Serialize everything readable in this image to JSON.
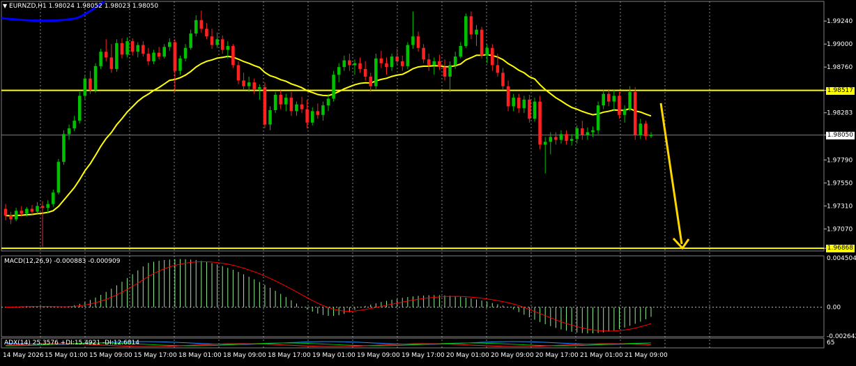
{
  "header": {
    "symbol_line": "EURNZD,H1  1.98024 1.98052 1.98023 1.98050",
    "dropdown_icon": "triangle-down-icon"
  },
  "colors": {
    "background": "#000000",
    "bull": "#00c000",
    "bear": "#ff2020",
    "ma_fast": "#ffff00",
    "ma_slow": "#0000ff",
    "level_line": "#ffff00",
    "macd_hist": "#90ee90",
    "macd_signal": "#ff0000",
    "grid": "#c0c0c0",
    "arrow": "#ffd700"
  },
  "levels": {
    "upper": {
      "value": 1.98517,
      "label": "1.98517"
    },
    "lower": {
      "value": 1.96868,
      "label": "1.96868"
    },
    "current": {
      "value": 1.9805,
      "label": "1.98050"
    }
  },
  "macd": {
    "label": "MACD(12,26,9) -0.000883 -0.000909",
    "ticks": [
      "0.004504",
      "0.00",
      "-0.002642"
    ]
  },
  "adx": {
    "label": "ADX(14) 25.3576 +DI:15.4921 -DI:12.6814",
    "tick": "65"
  },
  "time_labels": [
    "14 May 2026",
    "15 May 01:00",
    "15 May 09:00",
    "15 May 17:00",
    "18 May 01:00",
    "18 May 09:00",
    "18 May 17:00",
    "19 May 01:00",
    "19 May 09:00",
    "19 May 17:00",
    "20 May 01:00",
    "20 May 09:00",
    "20 May 17:00",
    "21 May 01:00",
    "21 May 09:00"
  ],
  "chart_data": {
    "type": "candlestick",
    "symbol": "EURNZD",
    "timeframe": "H1",
    "ylim": [
      1.9684,
      1.9946
    ],
    "price_ticks": [
      "1.99240",
      "1.99000",
      "1.98760",
      "1.98517",
      "1.98283",
      "1.98050",
      "1.97790",
      "1.97550",
      "1.97310",
      "1.97070",
      "1.96868"
    ],
    "candles": [
      [
        1.9728,
        1.9733,
        1.9716,
        1.9721
      ],
      [
        1.9721,
        1.9725,
        1.9712,
        1.9717
      ],
      [
        1.9717,
        1.9729,
        1.9715,
        1.9726
      ],
      [
        1.9726,
        1.9731,
        1.972,
        1.9723
      ],
      [
        1.9723,
        1.973,
        1.972,
        1.9728
      ],
      [
        1.9728,
        1.9732,
        1.9722,
        1.9725
      ],
      [
        1.9725,
        1.9735,
        1.9723,
        1.9731
      ],
      [
        1.9731,
        1.9736,
        1.9688,
        1.9729
      ],
      [
        1.9729,
        1.9737,
        1.9724,
        1.9733
      ],
      [
        1.9733,
        1.9748,
        1.973,
        1.9745
      ],
      [
        1.9745,
        1.978,
        1.9743,
        1.9777
      ],
      [
        1.9777,
        1.981,
        1.9774,
        1.9806
      ],
      [
        1.9806,
        1.9816,
        1.98,
        1.9812
      ],
      [
        1.9812,
        1.9825,
        1.9809,
        1.982
      ],
      [
        1.982,
        1.985,
        1.9817,
        1.9846
      ],
      [
        1.9846,
        1.9868,
        1.9842,
        1.9864
      ],
      [
        1.9864,
        1.9872,
        1.9848,
        1.9852
      ],
      [
        1.9852,
        1.988,
        1.9849,
        1.9877
      ],
      [
        1.9877,
        1.9895,
        1.9874,
        1.9892
      ],
      [
        1.9892,
        1.9905,
        1.9882,
        1.9886
      ],
      [
        1.9886,
        1.99,
        1.987,
        1.9874
      ],
      [
        1.9874,
        1.9905,
        1.9871,
        1.9901
      ],
      [
        1.9901,
        1.9906,
        1.9885,
        1.9889
      ],
      [
        1.9889,
        1.9907,
        1.9886,
        1.9903
      ],
      [
        1.9903,
        1.9906,
        1.9888,
        1.9892
      ],
      [
        1.9892,
        1.9902,
        1.9886,
        1.9899
      ],
      [
        1.9899,
        1.9903,
        1.9887,
        1.989
      ],
      [
        1.989,
        1.9896,
        1.9878,
        1.9882
      ],
      [
        1.9882,
        1.9894,
        1.9879,
        1.9891
      ],
      [
        1.9891,
        1.9897,
        1.9884,
        1.9887
      ],
      [
        1.9887,
        1.99,
        1.9885,
        1.9897
      ],
      [
        1.9897,
        1.9906,
        1.9893,
        1.9902
      ],
      [
        1.9902,
        1.9905,
        1.985,
        1.9872
      ],
      [
        1.9872,
        1.9888,
        1.9868,
        1.9885
      ],
      [
        1.9885,
        1.99,
        1.9882,
        1.9896
      ],
      [
        1.9896,
        1.9915,
        1.9894,
        1.9911
      ],
      [
        1.9911,
        1.993,
        1.9908,
        1.9925
      ],
      [
        1.9925,
        1.9935,
        1.9912,
        1.9916
      ],
      [
        1.9916,
        1.9922,
        1.9905,
        1.9908
      ],
      [
        1.9908,
        1.9916,
        1.9895,
        1.9899
      ],
      [
        1.9899,
        1.9912,
        1.9896,
        1.9905
      ],
      [
        1.9905,
        1.9909,
        1.989,
        1.9894
      ],
      [
        1.9894,
        1.9903,
        1.9885,
        1.9898
      ],
      [
        1.9898,
        1.99,
        1.9875,
        1.9878
      ],
      [
        1.9878,
        1.9882,
        1.9858,
        1.9862
      ],
      [
        1.9862,
        1.987,
        1.9852,
        1.9856
      ],
      [
        1.9856,
        1.9866,
        1.985,
        1.986
      ],
      [
        1.986,
        1.9864,
        1.9848,
        1.9853
      ],
      [
        1.9853,
        1.9858,
        1.9842,
        1.9855
      ],
      [
        1.9855,
        1.986,
        1.9812,
        1.9816
      ],
      [
        1.9816,
        1.9835,
        1.981,
        1.9831
      ],
      [
        1.9831,
        1.985,
        1.9828,
        1.9847
      ],
      [
        1.9847,
        1.9852,
        1.9832,
        1.9837
      ],
      [
        1.9837,
        1.9848,
        1.983,
        1.9844
      ],
      [
        1.9844,
        1.985,
        1.9825,
        1.983
      ],
      [
        1.983,
        1.984,
        1.9825,
        1.9837
      ],
      [
        1.9837,
        1.9845,
        1.9828,
        1.9832
      ],
      [
        1.9832,
        1.9842,
        1.9812,
        1.9818
      ],
      [
        1.9818,
        1.9834,
        1.9815,
        1.983
      ],
      [
        1.983,
        1.9838,
        1.9822,
        1.9826
      ],
      [
        1.9826,
        1.984,
        1.982,
        1.9836
      ],
      [
        1.9836,
        1.9848,
        1.983,
        1.9843
      ],
      [
        1.9843,
        1.9872,
        1.984,
        1.9868
      ],
      [
        1.9868,
        1.988,
        1.986,
        1.9876
      ],
      [
        1.9876,
        1.9888,
        1.9872,
        1.9883
      ],
      [
        1.9883,
        1.989,
        1.9872,
        1.9878
      ],
      [
        1.9878,
        1.9884,
        1.9868,
        1.988
      ],
      [
        1.988,
        1.9886,
        1.987,
        1.9874
      ],
      [
        1.9874,
        1.9882,
        1.9862,
        1.9866
      ],
      [
        1.9866,
        1.987,
        1.985,
        1.9856
      ],
      [
        1.9856,
        1.989,
        1.9853,
        1.9885
      ],
      [
        1.9885,
        1.9893,
        1.9875,
        1.988
      ],
      [
        1.988,
        1.9886,
        1.9868,
        1.9876
      ],
      [
        1.9876,
        1.989,
        1.9872,
        1.9887
      ],
      [
        1.9887,
        1.9895,
        1.9878,
        1.9882
      ],
      [
        1.9882,
        1.9888,
        1.9872,
        1.9877
      ],
      [
        1.9877,
        1.9902,
        1.9874,
        1.9899
      ],
      [
        1.9899,
        1.9934,
        1.9895,
        1.9908
      ],
      [
        1.9908,
        1.9913,
        1.9892,
        1.9896
      ],
      [
        1.9896,
        1.99,
        1.988,
        1.9884
      ],
      [
        1.9884,
        1.989,
        1.9872,
        1.9878
      ],
      [
        1.9878,
        1.9886,
        1.9868,
        1.9882
      ],
      [
        1.9882,
        1.9889,
        1.9873,
        1.9876
      ],
      [
        1.9876,
        1.9884,
        1.9862,
        1.9866
      ],
      [
        1.9866,
        1.9882,
        1.985,
        1.9878
      ],
      [
        1.9878,
        1.9892,
        1.9874,
        1.9887
      ],
      [
        1.9887,
        1.9902,
        1.9885,
        1.9898
      ],
      [
        1.9898,
        1.9932,
        1.9896,
        1.9929
      ],
      [
        1.9929,
        1.9934,
        1.9905,
        1.991
      ],
      [
        1.991,
        1.992,
        1.9898,
        1.9915
      ],
      [
        1.9915,
        1.9918,
        1.9885,
        1.9888
      ],
      [
        1.9888,
        1.99,
        1.988,
        1.9896
      ],
      [
        1.9896,
        1.99,
        1.9872,
        1.9878
      ],
      [
        1.9878,
        1.989,
        1.9866,
        1.987
      ],
      [
        1.987,
        1.9875,
        1.9852,
        1.9856
      ],
      [
        1.9856,
        1.9862,
        1.983,
        1.9835
      ],
      [
        1.9835,
        1.9848,
        1.983,
        1.9844
      ],
      [
        1.9844,
        1.9848,
        1.9828,
        1.9833
      ],
      [
        1.9833,
        1.9846,
        1.9828,
        1.9842
      ],
      [
        1.9842,
        1.9847,
        1.9818,
        1.9822
      ],
      [
        1.9822,
        1.9844,
        1.9819,
        1.984
      ],
      [
        1.984,
        1.9846,
        1.979,
        1.9795
      ],
      [
        1.9795,
        1.9803,
        1.9765,
        1.9798
      ],
      [
        1.9798,
        1.9808,
        1.9785,
        1.9803
      ],
      [
        1.9803,
        1.9808,
        1.9795,
        1.98
      ],
      [
        1.98,
        1.981,
        1.9796,
        1.9806
      ],
      [
        1.9806,
        1.981,
        1.9795,
        1.9799
      ],
      [
        1.9799,
        1.9806,
        1.9794,
        1.9801
      ],
      [
        1.9801,
        1.9815,
        1.9796,
        1.9812
      ],
      [
        1.9812,
        1.982,
        1.98,
        1.9805
      ],
      [
        1.9805,
        1.9813,
        1.98,
        1.9808
      ],
      [
        1.9808,
        1.9814,
        1.9803,
        1.981
      ],
      [
        1.981,
        1.984,
        1.9806,
        1.9836
      ],
      [
        1.9836,
        1.9852,
        1.9832,
        1.9848
      ],
      [
        1.9848,
        1.9853,
        1.9835,
        1.984
      ],
      [
        1.984,
        1.9852,
        1.983,
        1.9846
      ],
      [
        1.9846,
        1.985,
        1.9822,
        1.9826
      ],
      [
        1.9826,
        1.9836,
        1.9818,
        1.9832
      ],
      [
        1.9832,
        1.9856,
        1.983,
        1.985
      ],
      [
        1.985,
        1.9855,
        1.98,
        1.9805
      ],
      [
        1.9805,
        1.9822,
        1.9801,
        1.9817
      ],
      [
        1.9817,
        1.982,
        1.98,
        1.9804
      ],
      [
        1.9804,
        1.9808,
        1.9802,
        1.9805
      ]
    ],
    "ma_slow_name": "blue MA",
    "macd_hist_shape": "rises to ~0.0044, falls through zero near mid-chart, small positive bump, then negative to ~-0.0022, recovering",
    "arrow": "yellow down arrow from upper level to lower level",
    "grid": "dashed vertical"
  }
}
